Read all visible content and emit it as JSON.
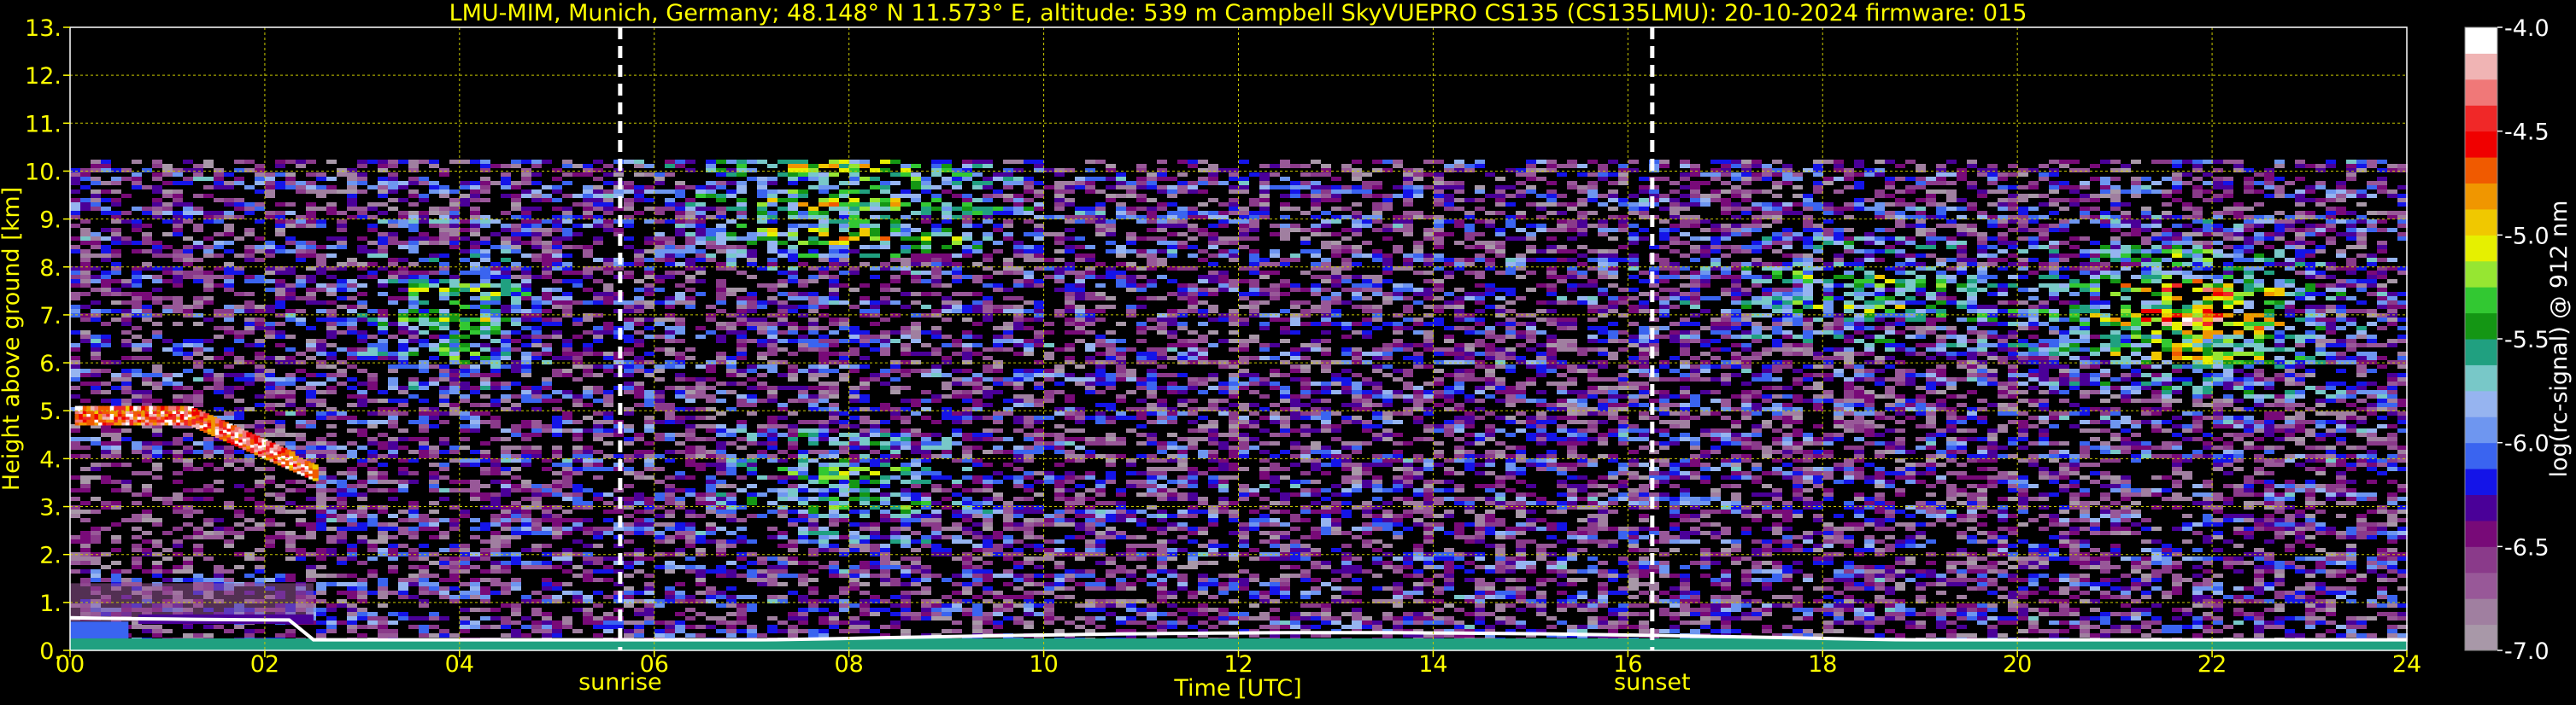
{
  "chart_data": {
    "type": "heatmap",
    "title": "LMU-MIM, Munich, Germany; 48.148° N 11.573° E, altitude: 539 m    Campbell SkyVUEPRO CS135 (CS135LMU): 20-10-2024    firmware: 015",
    "xlabel": "Time [UTC]",
    "ylabel": "Height above ground [km]",
    "xlim": [
      0,
      24
    ],
    "ylim": [
      0,
      13
    ],
    "x_ticks": [
      "00",
      "02",
      "04",
      "06",
      "08",
      "10",
      "12",
      "14",
      "16",
      "18",
      "20",
      "22",
      "24"
    ],
    "y_ticks": [
      "0.",
      "1.",
      "2.",
      "3.",
      "4.",
      "5.",
      "6.",
      "7.",
      "8.",
      "9.",
      "10.",
      "11.",
      "12.",
      "13."
    ],
    "grid": true,
    "grid_color": "#c8c800",
    "events": [
      {
        "label": "sunrise",
        "time": 5.65
      },
      {
        "label": "sunset",
        "time": 16.25
      }
    ],
    "colorbar": {
      "label": "log(rc-signal) @ 912 nm",
      "range": [
        -7.0,
        -4.0
      ],
      "ticks": [
        "-4.0",
        "-4.5",
        "-5.0",
        "-5.5",
        "-6.0",
        "-6.5",
        "-7.0"
      ],
      "colors": [
        "#a898a8",
        "#a07fa0",
        "#985898",
        "#8a3a8a",
        "#780a78",
        "#4a0098",
        "#1414e8",
        "#3a64f0",
        "#6e96f0",
        "#96b4f0",
        "#78c8c8",
        "#20a080",
        "#149614",
        "#32c832",
        "#96e632",
        "#e6f000",
        "#f0c800",
        "#f09600",
        "#f05a00",
        "#f00000",
        "#f02828",
        "#f07878",
        "#f0b4b4",
        "#ffffff"
      ]
    },
    "features": [
      {
        "name": "boundary layer / surface return",
        "x": [
          0,
          24
        ],
        "y": [
          0,
          0.4
        ]
      },
      {
        "name": "low cloud layer",
        "x": [
          0,
          2.5
        ],
        "y": [
          4.0,
          5.2
        ]
      },
      {
        "name": "aerosol/noise layer",
        "x": [
          0,
          2.5
        ],
        "y": [
          0.6,
          1.4
        ]
      },
      {
        "name": "signal top cutoff",
        "x": [
          0,
          24
        ],
        "y": [
          10.25,
          10.25
        ]
      }
    ]
  }
}
